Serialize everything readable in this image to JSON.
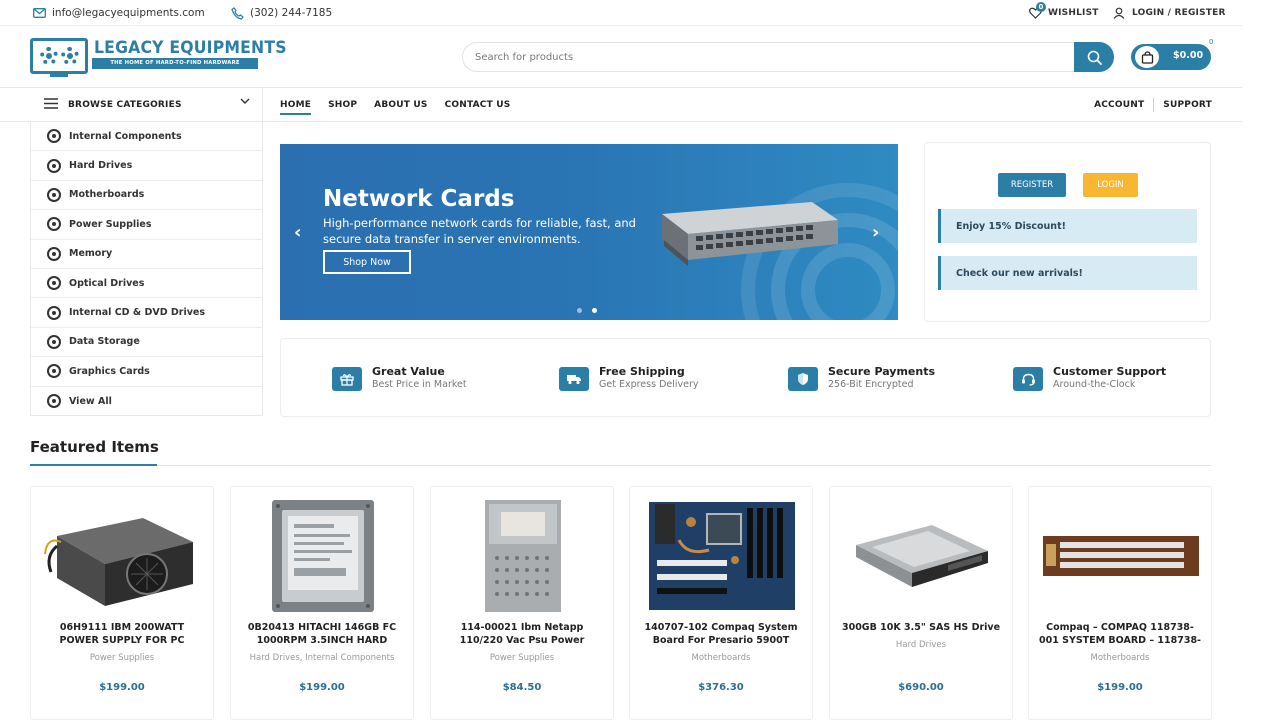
{
  "topbar": {
    "email": "info@legacyequipments.com",
    "phone": "(302) 244-7185",
    "wishlist_label": "WISHLIST",
    "wishlist_count": "0",
    "login_label": "LOGIN / REGISTER"
  },
  "logo": {
    "name": "LEGACY EQUIPMENTS",
    "tagline": "THE HOME OF HARD-TO-FIND HARDWARE"
  },
  "search": {
    "placeholder": "Search for products"
  },
  "cart": {
    "amount": "$0.00",
    "count": "0"
  },
  "nav": {
    "browse_label": "BROWSE CATEGORIES",
    "menu": [
      "HOME",
      "SHOP",
      "ABOUT US",
      "CONTACT US"
    ],
    "right": [
      "ACCOUNT",
      "SUPPORT"
    ]
  },
  "categories": [
    "Internal Components",
    "Hard Drives",
    "Motherboards",
    "Power Supplies",
    "Memory",
    "Optical Drives",
    "Internal CD & DVD Drives",
    "Data Storage",
    "Graphics Cards",
    "View All"
  ],
  "banner": {
    "title": "Network Cards",
    "description": "High-performance network cards for reliable, fast, and secure data transfer in server environments.",
    "button": "Shop Now",
    "slide_count": 2,
    "active_slide": 2
  },
  "panel": {
    "register": "REGISTER",
    "login": "LOGIN",
    "notes": [
      "Enjoy 15% Discount!",
      "Check our new arrivals!"
    ]
  },
  "features": [
    {
      "title": "Great Value",
      "subtitle": "Best Price in Market",
      "icon": "gift-icon"
    },
    {
      "title": "Free Shipping",
      "subtitle": "Get Express Delivery",
      "icon": "truck-icon"
    },
    {
      "title": "Secure Payments",
      "subtitle": "256-Bit Encrypted",
      "icon": "shield-icon"
    },
    {
      "title": "Customer Support",
      "subtitle": "Around-the-Clock",
      "icon": "headset-icon"
    }
  ],
  "featured": {
    "title": "Featured Items",
    "products": [
      {
        "name": "06H9111 IBM 200WATT POWER SUPPLY FOR PC",
        "category": "Power Supplies",
        "price": "$199.00",
        "image": "power-supply-image"
      },
      {
        "name": "0B20413 HITACHI 146GB FC 1000RPM 3.5INCH HARD",
        "category": "Hard Drives, Internal Components",
        "price": "$199.00",
        "image": "hard-drive-image"
      },
      {
        "name": "114-00021 Ibm Netapp 110/220 Vac Psu Power",
        "category": "Power Supplies",
        "price": "$84.50",
        "image": "psu-image"
      },
      {
        "name": "140707-102 Compaq System Board For Presario 5900T",
        "category": "Motherboards",
        "price": "$376.30",
        "image": "motherboard-image"
      },
      {
        "name": "300GB 10K 3.5\" SAS HS Drive",
        "category": "Hard Drives",
        "price": "$690.00",
        "image": "sas-drive-image"
      },
      {
        "name": "Compaq – COMPAQ 118738-001 SYSTEM BOARD – 118738-",
        "category": "Motherboards",
        "price": "$199.00",
        "image": "system-board-image"
      }
    ]
  },
  "colors": {
    "accent": "#2b7fa6",
    "login_button": "#f7b731",
    "note_bg": "#d7ebf4"
  }
}
